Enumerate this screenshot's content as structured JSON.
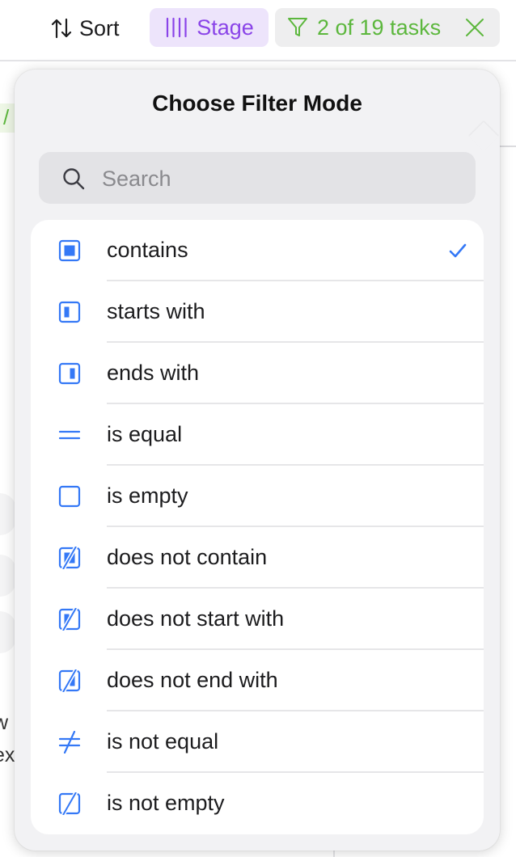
{
  "toolbar": {
    "sort_label": "Sort",
    "stage_label": "Stage",
    "filter_label": "2 of 19 tasks"
  },
  "background": {
    "left_fragment": "/",
    "text_fragment_1": "w",
    "text_fragment_2": "ex"
  },
  "popover": {
    "title": "Choose Filter Mode",
    "search_placeholder": "Search",
    "search_value": "",
    "options": [
      {
        "label": "contains",
        "icon": "contains-icon",
        "selected": true
      },
      {
        "label": "starts with",
        "icon": "starts-with-icon",
        "selected": false
      },
      {
        "label": "ends with",
        "icon": "ends-with-icon",
        "selected": false
      },
      {
        "label": "is equal",
        "icon": "equal-icon",
        "selected": false
      },
      {
        "label": "is empty",
        "icon": "empty-icon",
        "selected": false
      },
      {
        "label": "does not contain",
        "icon": "not-contains-icon",
        "selected": false
      },
      {
        "label": "does not start with",
        "icon": "not-starts-with-icon",
        "selected": false
      },
      {
        "label": "does not end with",
        "icon": "not-ends-with-icon",
        "selected": false
      },
      {
        "label": "is not equal",
        "icon": "not-equal-icon",
        "selected": false
      },
      {
        "label": "is not empty",
        "icon": "not-empty-icon",
        "selected": false
      }
    ]
  },
  "colors": {
    "accent_blue": "#3478f6",
    "stage_purple": "#8a44e8",
    "stage_bg": "#ede4fb",
    "filter_green": "#5cb73d"
  }
}
